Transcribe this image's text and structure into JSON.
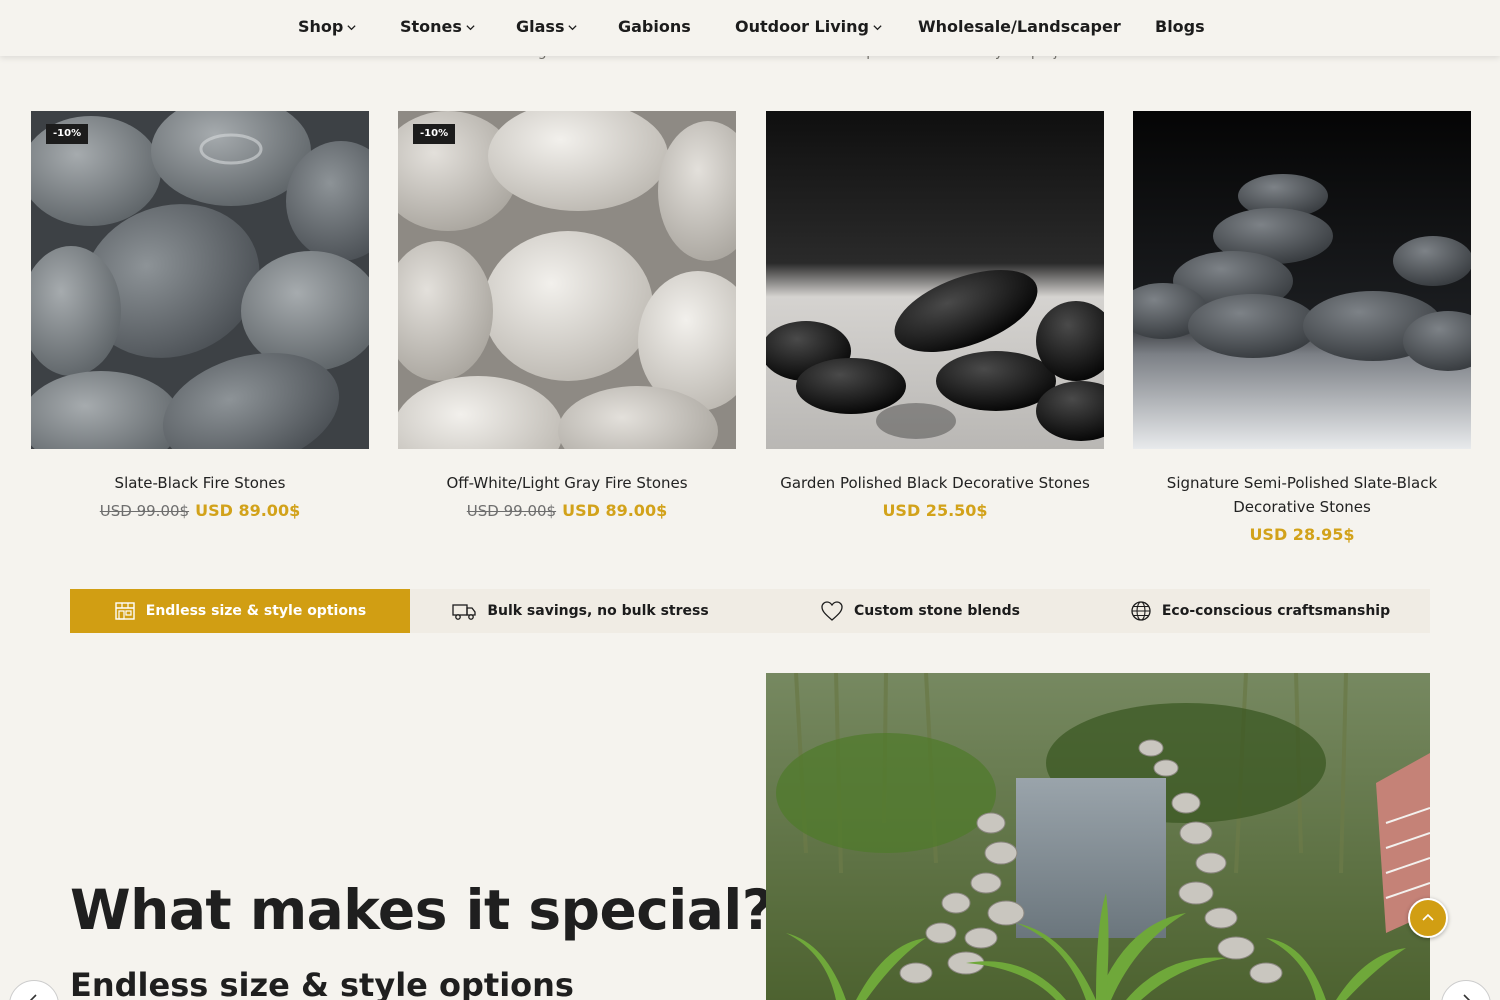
{
  "nav": {
    "items": [
      {
        "label": "Shop",
        "has_dropdown": true
      },
      {
        "label": "Stones",
        "has_dropdown": true
      },
      {
        "label": "Glass",
        "has_dropdown": true
      },
      {
        "label": "Gabions",
        "has_dropdown": false
      },
      {
        "label": "Outdoor Living",
        "has_dropdown": true
      },
      {
        "label": "Wholesale/Landscaper",
        "has_dropdown": false
      },
      {
        "label": "Blogs",
        "has_dropdown": false
      }
    ]
  },
  "section": {
    "subtitle": "Discover our design ideas or consult our advisors to choose the perfect stones for your project."
  },
  "products": [
    {
      "title": "Slate-Black Fire Stones",
      "badge": "-10%",
      "old_price": "USD 99.00$",
      "price": "USD 89.00$"
    },
    {
      "title": "Off-White/Light Gray Fire Stones",
      "badge": "-10%",
      "old_price": "USD 99.00$",
      "price": "USD 89.00$"
    },
    {
      "title": "Garden Polished Black Decorative Stones",
      "price": "USD 25.50$"
    },
    {
      "title": "Signature Semi-Polished Slate-Black Decorative Stones",
      "price": "USD 28.95$"
    }
  ],
  "features": {
    "tabs": [
      {
        "label": "Endless size & style options",
        "icon": "storefront-icon",
        "active": true
      },
      {
        "label": "Bulk savings, no bulk stress",
        "icon": "truck-icon",
        "active": false
      },
      {
        "label": "Custom stone blends",
        "icon": "heart-icon",
        "active": false
      },
      {
        "label": "Eco-conscious craftsmanship",
        "icon": "globe-icon",
        "active": false
      }
    ]
  },
  "special": {
    "heading": "What makes it special?",
    "subheading": "Endless size & style options"
  },
  "colors": {
    "accent": "#d19e13",
    "price": "#d2a21a",
    "background": "#f5f3ee"
  }
}
